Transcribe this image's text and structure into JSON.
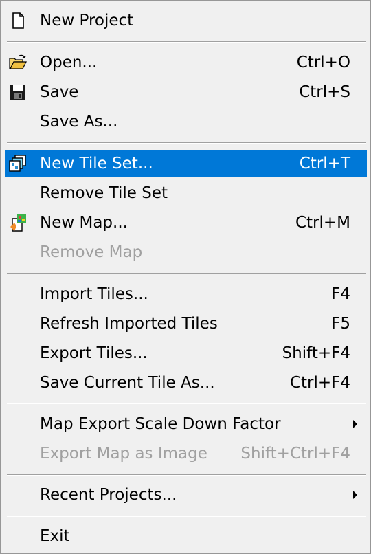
{
  "menu": {
    "new_project": {
      "label": "New Project",
      "icon": "new-document-icon"
    },
    "open": {
      "label": "Open...",
      "shortcut": "Ctrl+O",
      "icon": "open-folder-icon"
    },
    "save": {
      "label": "Save",
      "shortcut": "Ctrl+S",
      "icon": "floppy-disk-icon"
    },
    "save_as": {
      "label": "Save As..."
    },
    "new_tile_set": {
      "label": "New Tile Set...",
      "shortcut": "Ctrl+T",
      "icon": "tile-set-icon",
      "state": "highlighted"
    },
    "remove_tile_set": {
      "label": "Remove Tile Set"
    },
    "new_map": {
      "label": "New Map...",
      "shortcut": "Ctrl+M",
      "icon": "new-map-icon"
    },
    "remove_map": {
      "label": "Remove Map",
      "state": "disabled"
    },
    "import_tiles": {
      "label": "Import Tiles...",
      "shortcut": "F4"
    },
    "refresh_imported_tiles": {
      "label": "Refresh Imported Tiles",
      "shortcut": "F5"
    },
    "export_tiles": {
      "label": "Export Tiles...",
      "shortcut": "Shift+F4"
    },
    "save_current_tile_as": {
      "label": "Save Current Tile As...",
      "shortcut": "Ctrl+F4"
    },
    "map_export_scale_down_factor": {
      "label": "Map Export Scale Down Factor",
      "submenu": true
    },
    "export_map_as_image": {
      "label": "Export Map as Image",
      "shortcut": "Shift+Ctrl+F4",
      "state": "disabled"
    },
    "recent_projects": {
      "label": "Recent Projects...",
      "submenu": true
    },
    "exit": {
      "label": "Exit"
    }
  },
  "colors": {
    "menu_background": "#f0f0f0",
    "highlight": "#0078d7",
    "disabled_text": "#a0a0a0",
    "border": "#979797"
  }
}
